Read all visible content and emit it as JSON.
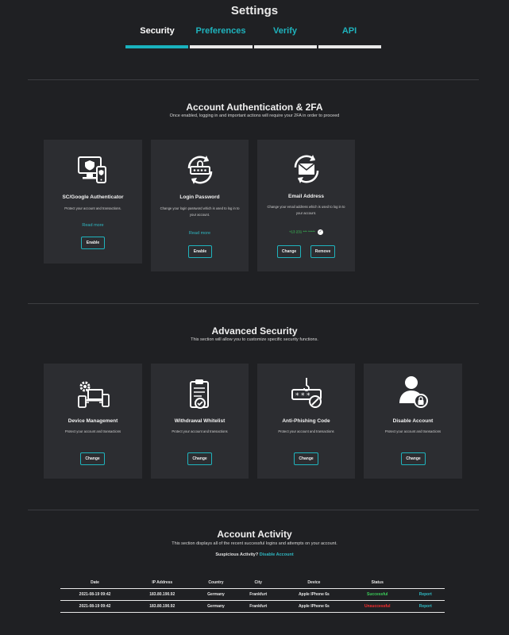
{
  "page": {
    "title": "Settings"
  },
  "tabs": [
    {
      "label": "Security",
      "active": true
    },
    {
      "label": "Preferences",
      "active": false
    },
    {
      "label": "Verify",
      "active": false
    },
    {
      "label": "API",
      "active": false
    }
  ],
  "auth_section": {
    "title": "Account Authentication & 2FA",
    "subtitle": "Once enabled, logging in and important actions will require your 2FA in order to proceed",
    "cards": [
      {
        "icon": "authenticator-devices-icon",
        "title": "SC/Google Authenticator",
        "description": "Protect your account and transactions.",
        "read_more": "Read more",
        "button": "Enable"
      },
      {
        "icon": "login-password-icon",
        "title": "Login Password",
        "description": "Change your login password which is used to log in to your account.",
        "read_more": "Read more",
        "button": "Enable"
      },
      {
        "icon": "email-sync-icon",
        "title": "Email Address",
        "description": "Change your email address which is used to log in to your account.",
        "phone": "+13 231 *** *****",
        "buttons": [
          "Change",
          "Remove"
        ]
      }
    ]
  },
  "advanced_section": {
    "title": "Advanced Security",
    "subtitle": "This section will allow you to customize specific security functions.",
    "cards": [
      {
        "icon": "device-management-icon",
        "title": "Device Management",
        "description": "Protect your account and transactions",
        "button": "Change"
      },
      {
        "icon": "withdrawal-whitelist-icon",
        "title": "Withdrawal Whitelist",
        "description": "Protect your account and transactions",
        "button": "Change"
      },
      {
        "icon": "anti-phishing-icon",
        "title": "Anti-Phishing Code",
        "description": "Protect your account and transactions",
        "button": "Change"
      },
      {
        "icon": "disable-account-icon",
        "title": "Disable Account",
        "description": "Protect your account and transactions",
        "button": "Change"
      }
    ]
  },
  "activity_section": {
    "title": "Account Activity",
    "subtitle": "This section displays all of the recent successful logins and attempts on your account.",
    "suspicious_text": "Suspicious Activity?",
    "suspicious_link": "Disable Account",
    "columns": [
      "Date",
      "IP Address",
      "Country",
      "City",
      "Device",
      "Status",
      ""
    ],
    "rows": [
      {
        "date": "2021-08-19 09:42",
        "ip": "183.80.190.92",
        "country": "Germany",
        "city": "Frankfurt",
        "device": "Apple IPhone 6s",
        "status": "Successful",
        "action": "Report"
      },
      {
        "date": "2021-08-19 09:42",
        "ip": "183.80.190.92",
        "country": "Germany",
        "city": "Frankfurt",
        "device": "Apple IPhone 6s",
        "status": "Unsuccessful",
        "action": "Report"
      }
    ]
  },
  "colors": {
    "accent": "#19b2be",
    "background": "#1f2023",
    "card": "#2c2d31",
    "success": "#3ccf5a",
    "error": "#ff2f2f"
  }
}
